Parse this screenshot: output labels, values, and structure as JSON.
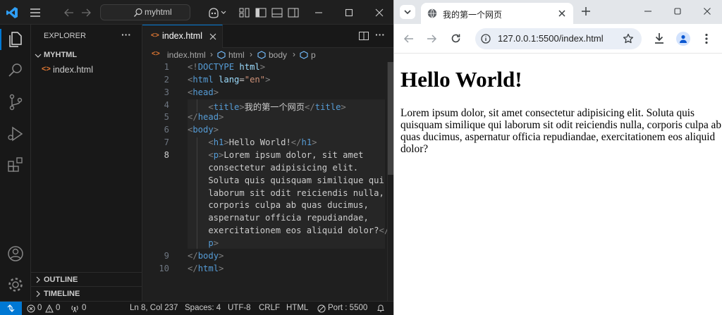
{
  "vscode": {
    "search_text": "myhtml",
    "explorer_title": "EXPLORER",
    "more_dots": "···",
    "folder_name": "MYHTML",
    "file_name": "index.html",
    "outline_label": "OUTLINE",
    "timeline_label": "TIMELINE",
    "tab_label": "index.html",
    "breadcrumbs": [
      "index.html",
      "html",
      "body",
      "p"
    ],
    "code_lines": [
      {
        "n": "1",
        "segs": [
          [
            "tb",
            "<!"
          ],
          [
            "tg",
            "DOCTYPE"
          ],
          [
            "tx",
            " "
          ],
          [
            "at",
            "html"
          ],
          [
            "tb",
            ">"
          ]
        ]
      },
      {
        "n": "2",
        "segs": [
          [
            "tb",
            "<"
          ],
          [
            "tg",
            "html"
          ],
          [
            "tx",
            " "
          ],
          [
            "at",
            "lang"
          ],
          [
            "tx",
            "="
          ],
          [
            "st",
            "\"en\""
          ],
          [
            "tb",
            ">"
          ]
        ]
      },
      {
        "n": "3",
        "segs": [
          [
            "tb",
            "<"
          ],
          [
            "tg",
            "head"
          ],
          [
            "tb",
            ">"
          ]
        ]
      },
      {
        "n": "4",
        "segs": [
          [
            "tx",
            "    "
          ],
          [
            "tb",
            "<"
          ],
          [
            "tg",
            "title"
          ],
          [
            "tb",
            ">"
          ],
          [
            "tx",
            "我的第一个网页"
          ],
          [
            "tb",
            "</"
          ],
          [
            "tg",
            "title"
          ],
          [
            "tb",
            ">"
          ]
        ]
      },
      {
        "n": "5",
        "segs": [
          [
            "tb",
            "</"
          ],
          [
            "tg",
            "head"
          ],
          [
            "tb",
            ">"
          ]
        ]
      },
      {
        "n": "6",
        "segs": [
          [
            "tb",
            "<"
          ],
          [
            "tg",
            "body"
          ],
          [
            "tb",
            ">"
          ]
        ]
      },
      {
        "n": "7",
        "segs": [
          [
            "tx",
            "    "
          ],
          [
            "tb",
            "<"
          ],
          [
            "tg",
            "h1"
          ],
          [
            "tb",
            ">"
          ],
          [
            "tx",
            "Hello World!"
          ],
          [
            "tb",
            "</"
          ],
          [
            "tg",
            "h1"
          ],
          [
            "tb",
            ">"
          ]
        ]
      },
      {
        "n": "8",
        "segs": [
          [
            "tx",
            "    "
          ],
          [
            "tb",
            "<"
          ],
          [
            "tg",
            "p"
          ],
          [
            "tb",
            ">"
          ],
          [
            "tx",
            "Lorem ipsum dolor, sit amet"
          ]
        ]
      },
      {
        "n": "",
        "segs": [
          [
            "tx",
            "    consectetur adipisicing elit."
          ]
        ]
      },
      {
        "n": "",
        "segs": [
          [
            "tx",
            "    Soluta quis quisquam similique qui"
          ]
        ]
      },
      {
        "n": "",
        "segs": [
          [
            "tx",
            "    laborum sit odit reiciendis nulla,"
          ]
        ]
      },
      {
        "n": "",
        "segs": [
          [
            "tx",
            "    corporis culpa ab quas ducimus,"
          ]
        ]
      },
      {
        "n": "",
        "segs": [
          [
            "tx",
            "    aspernatur officia repudiandae,"
          ]
        ]
      },
      {
        "n": "",
        "segs": [
          [
            "tx",
            "    exercitationem eos aliquid dolor?"
          ],
          [
            "tb",
            "</"
          ]
        ]
      },
      {
        "n": "",
        "segs": [
          [
            "tx",
            "    "
          ],
          [
            "tg",
            "p"
          ],
          [
            "tb",
            ">"
          ]
        ]
      },
      {
        "n": "9",
        "segs": [
          [
            "tb",
            "</"
          ],
          [
            "tg",
            "body"
          ],
          [
            "tb",
            ">"
          ]
        ]
      },
      {
        "n": "10",
        "segs": [
          [
            "tb",
            "</"
          ],
          [
            "tg",
            "html"
          ],
          [
            "tb",
            ">"
          ]
        ]
      }
    ],
    "status": {
      "errors": "0",
      "warnings": "0",
      "ports": "0",
      "position": "Ln 8, Col 237",
      "spaces": "Spaces: 4",
      "encoding": "UTF-8",
      "eol": "CRLF",
      "language": "HTML",
      "port": "Port : 5500"
    }
  },
  "chrome": {
    "tab_title": "我的第一个网页",
    "url": "127.0.0.1:5500/index.html",
    "page_heading": "Hello World!",
    "page_paragraph": "Lorem ipsum dolor, sit amet consectetur adipisicing elit. Soluta quis quisquam similique qui laborum sit odit reiciendis nulla, corporis culpa ab quas ducimus, aspernatur officia repudiandae, exercitationem eos aliquid dolor?"
  },
  "colors": {
    "vscode_bg": "#1f1f1f",
    "vscode_accent": "#0078d4",
    "tag": "#569cd6",
    "attribute": "#9cdcfe",
    "string": "#ce9178",
    "chrome_tabbar": "#e3e6ea",
    "chrome_omnibox": "#e9eef6"
  },
  "icons": [
    "vscode-logo",
    "menu-icon",
    "back-arrow-icon",
    "forward-arrow-icon",
    "search-icon",
    "copilot-icon",
    "layout-icon",
    "minimize-icon",
    "maximize-icon",
    "close-icon",
    "files-icon",
    "source-control-icon",
    "run-debug-icon",
    "extensions-icon",
    "account-icon",
    "settings-icon",
    "html-file-icon",
    "split-editor-icon",
    "error-icon",
    "warning-icon",
    "broadcast-icon",
    "bell-icon",
    "chrome-logo",
    "reload-icon",
    "info-icon",
    "star-icon",
    "download-icon",
    "profile-icon",
    "kebab-menu-icon"
  ]
}
